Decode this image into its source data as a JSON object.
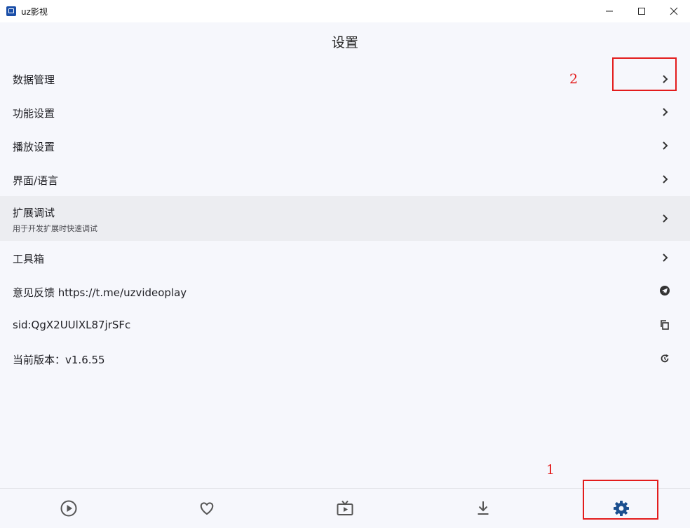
{
  "window": {
    "title": "uz影视",
    "controls": [
      "minimize",
      "maximize",
      "close"
    ]
  },
  "page": {
    "title": "设置"
  },
  "settings": [
    {
      "label": "数据管理",
      "icon": "chevron-right-icon"
    },
    {
      "label": "功能设置",
      "icon": "chevron-right-icon"
    },
    {
      "label": "播放设置",
      "icon": "chevron-right-icon"
    },
    {
      "label": "界面/语言",
      "icon": "chevron-right-icon"
    },
    {
      "label": "扩展调试",
      "sublabel": "用于开发扩展时快速调试",
      "icon": "chevron-right-icon",
      "highlighted": true
    },
    {
      "label": "工具箱",
      "icon": "chevron-right-icon"
    },
    {
      "label": "意见反馈 https://t.me/uzvideoplay",
      "icon": "telegram-icon"
    },
    {
      "label": "sid:QgX2UUlXL87jrSFc",
      "icon": "copy-icon"
    },
    {
      "label": "当前版本：v1.6.55",
      "icon": "refresh-icon"
    }
  ],
  "annotations": {
    "one": "1",
    "two": "2",
    "color": "#e31c1c"
  },
  "bottom_nav": {
    "items": [
      {
        "icon": "play-circle-icon",
        "active": false
      },
      {
        "icon": "heart-icon",
        "active": false
      },
      {
        "icon": "tv-icon",
        "active": false
      },
      {
        "icon": "download-icon",
        "active": false
      },
      {
        "icon": "gear-icon",
        "active": true
      }
    ],
    "active_color": "#1b4f8f",
    "inactive_color": "#555555"
  }
}
